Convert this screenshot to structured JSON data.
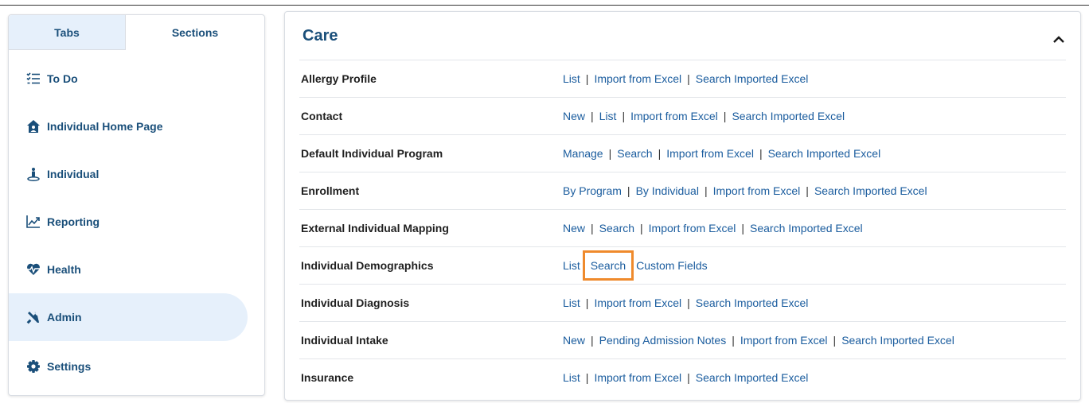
{
  "nav": {
    "tabs": [
      "Tabs",
      "Sections"
    ],
    "items": [
      {
        "label": "To Do",
        "icon": "checklist-icon"
      },
      {
        "label": "Individual Home Page",
        "icon": "house-user-icon"
      },
      {
        "label": "Individual",
        "icon": "person-pin-icon"
      },
      {
        "label": "Reporting",
        "icon": "line-chart-icon"
      },
      {
        "label": "Health",
        "icon": "heart-pulse-icon"
      },
      {
        "label": "Admin",
        "icon": "tools-icon",
        "active": true
      },
      {
        "label": "Settings",
        "icon": "gear-icon"
      }
    ]
  },
  "main": {
    "title": "Care",
    "rows": [
      {
        "label": "Allergy Profile",
        "links": [
          "List",
          "Import from Excel",
          "Search Imported Excel"
        ]
      },
      {
        "label": "Contact",
        "links": [
          "New",
          "List",
          "Import from Excel",
          "Search Imported Excel"
        ]
      },
      {
        "label": "Default Individual Program",
        "links": [
          "Manage",
          "Search",
          "Import from Excel",
          "Search Imported Excel"
        ]
      },
      {
        "label": "Enrollment",
        "links": [
          "By Program",
          "By Individual",
          "Import from Excel",
          "Search Imported Excel"
        ]
      },
      {
        "label": "External Individual Mapping",
        "links": [
          "New",
          "Search",
          "Import from Excel",
          "Search Imported Excel"
        ]
      },
      {
        "label": "Individual Demographics",
        "links": [
          "List",
          "Search",
          "Custom Fields"
        ],
        "highlight_index": 1
      },
      {
        "label": "Individual Diagnosis",
        "links": [
          "List",
          "Import from Excel",
          "Search Imported Excel"
        ]
      },
      {
        "label": "Individual Intake",
        "links": [
          "New",
          "Pending Admission Notes",
          "Import from Excel",
          "Search Imported Excel"
        ]
      },
      {
        "label": "Insurance",
        "links": [
          "List",
          "Import from Excel",
          "Search Imported Excel"
        ]
      }
    ]
  },
  "colors": {
    "accent": "#1a4f7a",
    "link": "#1a5c9e",
    "active_bg": "#e6f0fb",
    "highlight": "#ef8a2c"
  }
}
